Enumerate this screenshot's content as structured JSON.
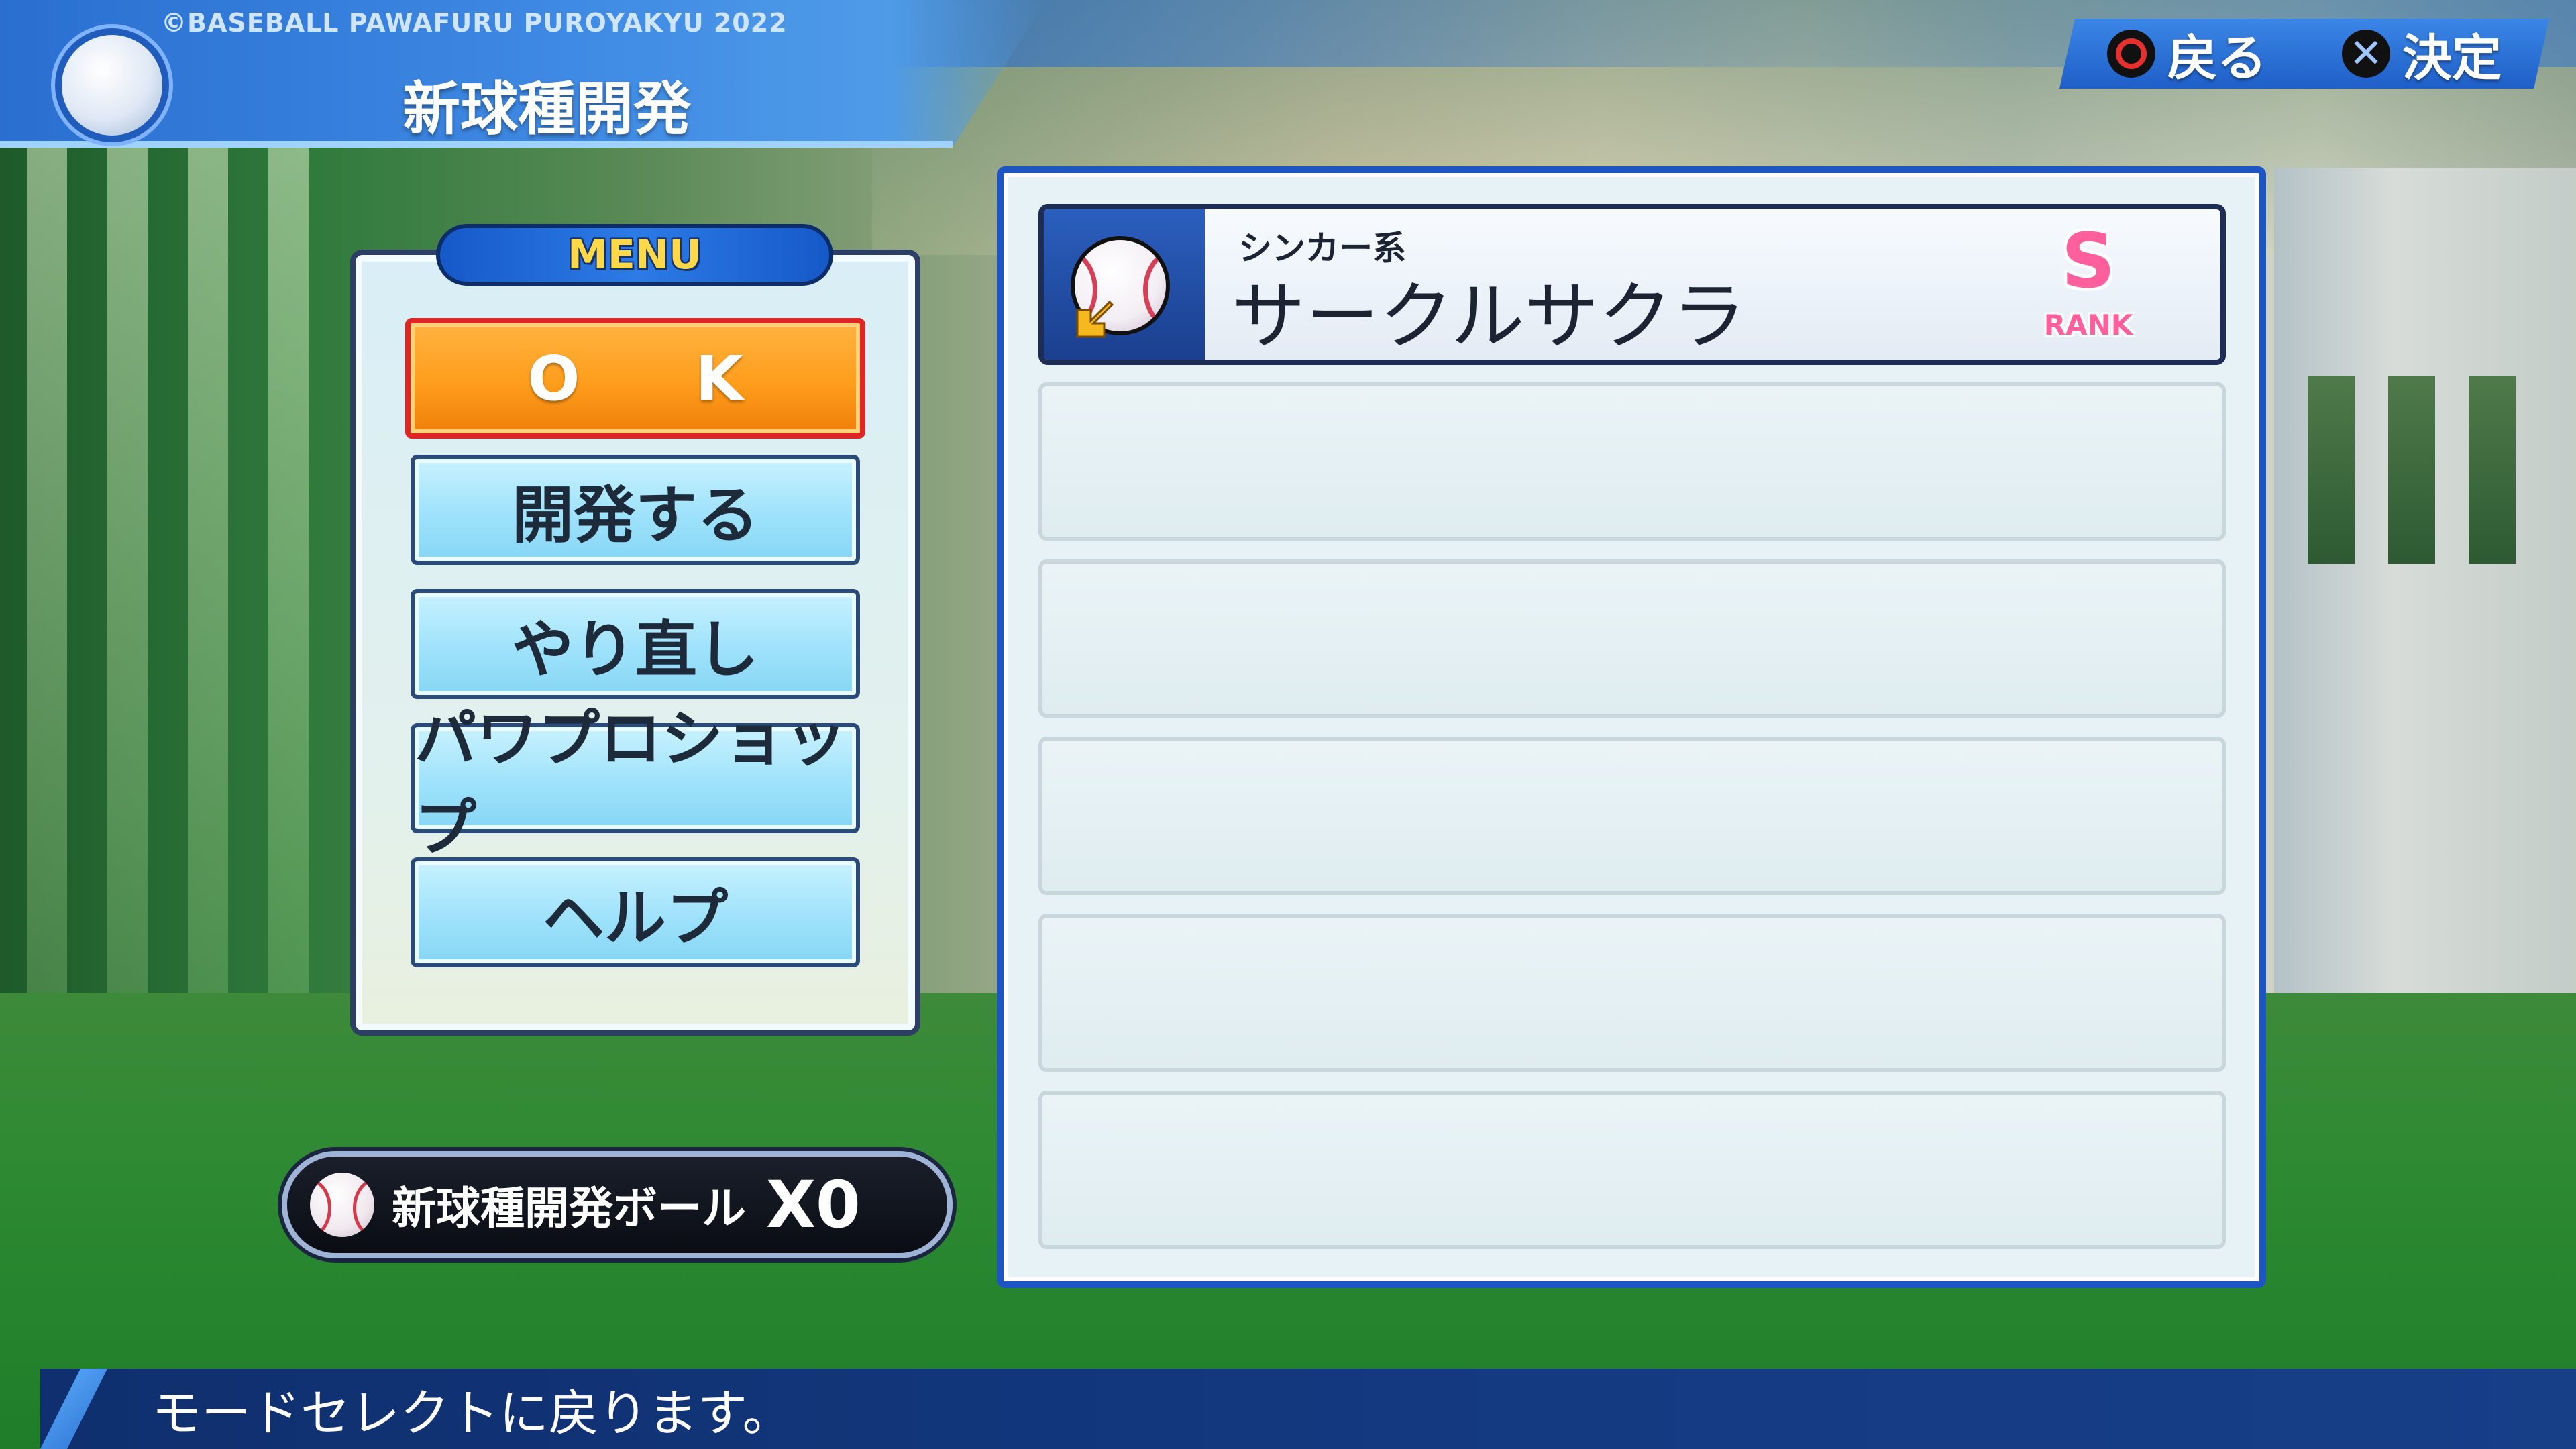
{
  "header": {
    "copyright": "©BASEBALL PAWAFURU PUROYAKYU 2022",
    "title": "新球種開発",
    "logo_icon": "baseball-logo-icon"
  },
  "hints": {
    "back_label": "戻る",
    "confirm_label": "決定"
  },
  "menu": {
    "tab_label": "MENU",
    "items": [
      {
        "label": "O K",
        "selected": true
      },
      {
        "label": "開発する",
        "selected": false
      },
      {
        "label": "やり直し",
        "selected": false
      },
      {
        "label": "パワプロショップ",
        "selected": false
      },
      {
        "label": "ヘルプ",
        "selected": false
      }
    ]
  },
  "ball_count": {
    "label": "新球種開発ボール",
    "value": "X0"
  },
  "pitch_list": {
    "entries": [
      {
        "category": "シンカー系",
        "name": "サークルサクラ",
        "rank": "S",
        "rank_word": "RANK"
      }
    ],
    "empty_slots": 5
  },
  "footer": {
    "message": "モードセレクトに戻ります。"
  },
  "colors": {
    "accent_blue": "#1e55c4",
    "selected_orange": "#ff9d1c",
    "selected_border": "#e02525",
    "rank_pink": "#ff5f9c"
  }
}
